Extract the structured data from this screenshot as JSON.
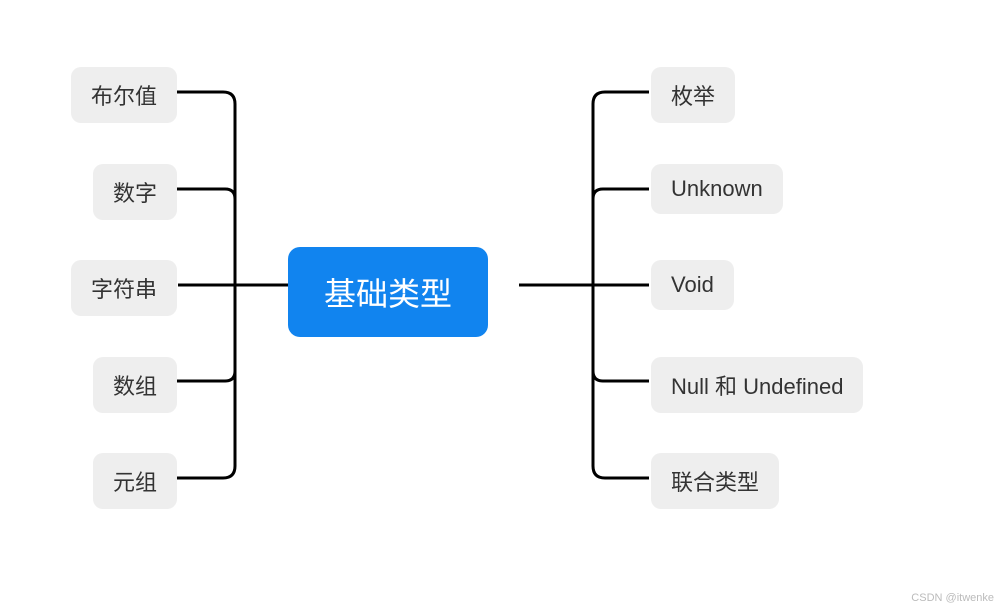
{
  "center": {
    "label": "基础类型"
  },
  "left": [
    {
      "label": "布尔值"
    },
    {
      "label": "数字"
    },
    {
      "label": "字符串"
    },
    {
      "label": "数组"
    },
    {
      "label": "元组"
    }
  ],
  "right": [
    {
      "label": "枚举"
    },
    {
      "label": "Unknown"
    },
    {
      "label": "Void"
    },
    {
      "label": "Null 和 Undefined"
    },
    {
      "label": "联合类型"
    }
  ],
  "watermark": "CSDN @itwenke"
}
